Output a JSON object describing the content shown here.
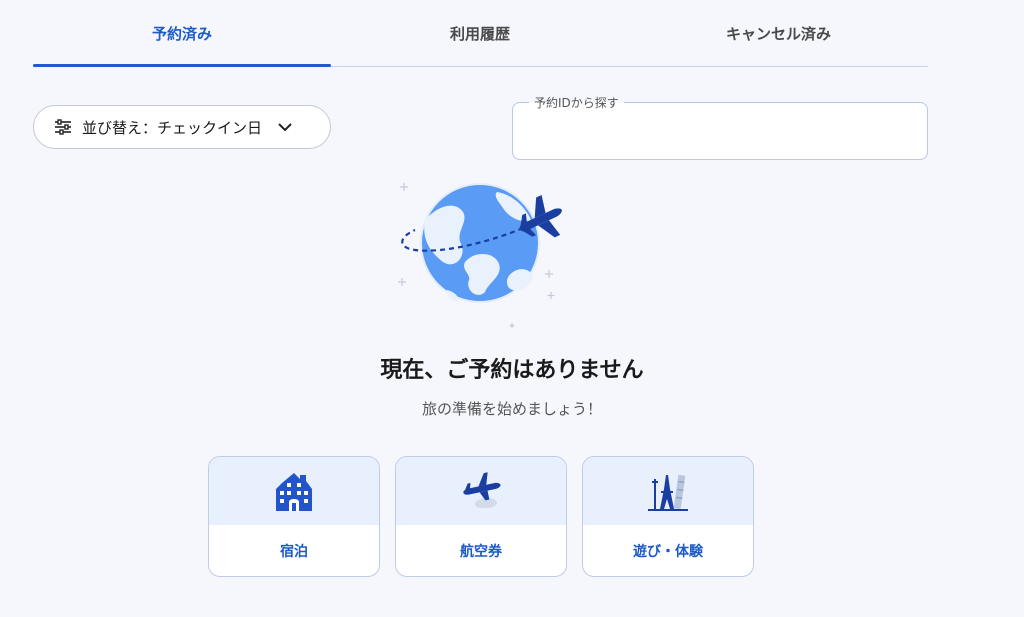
{
  "tabs": [
    {
      "label": "予約済み",
      "active": true
    },
    {
      "label": "利用履歴",
      "active": false
    },
    {
      "label": "キャンセル済み",
      "active": false
    }
  ],
  "sort": {
    "label": "並び替え：チェックイン日",
    "icon": "sliders-icon",
    "chevron": "chevron-down-icon"
  },
  "search": {
    "legend": "予約IDから探す",
    "value": "",
    "placeholder": ""
  },
  "empty_state": {
    "title": "現在、ご予約はありません",
    "subtitle": "旅の準備を始めましょう！",
    "illustration": "globe-airplane-illustration"
  },
  "categories": [
    {
      "label": "宿泊",
      "icon": "hotel-icon"
    },
    {
      "label": "航空券",
      "icon": "airplane-icon"
    },
    {
      "label": "遊び・体験",
      "icon": "landmarks-icon"
    }
  ],
  "colors": {
    "accent": "#1e5bc6",
    "background": "#f5f7fc",
    "card_top": "#e9f0fd"
  }
}
